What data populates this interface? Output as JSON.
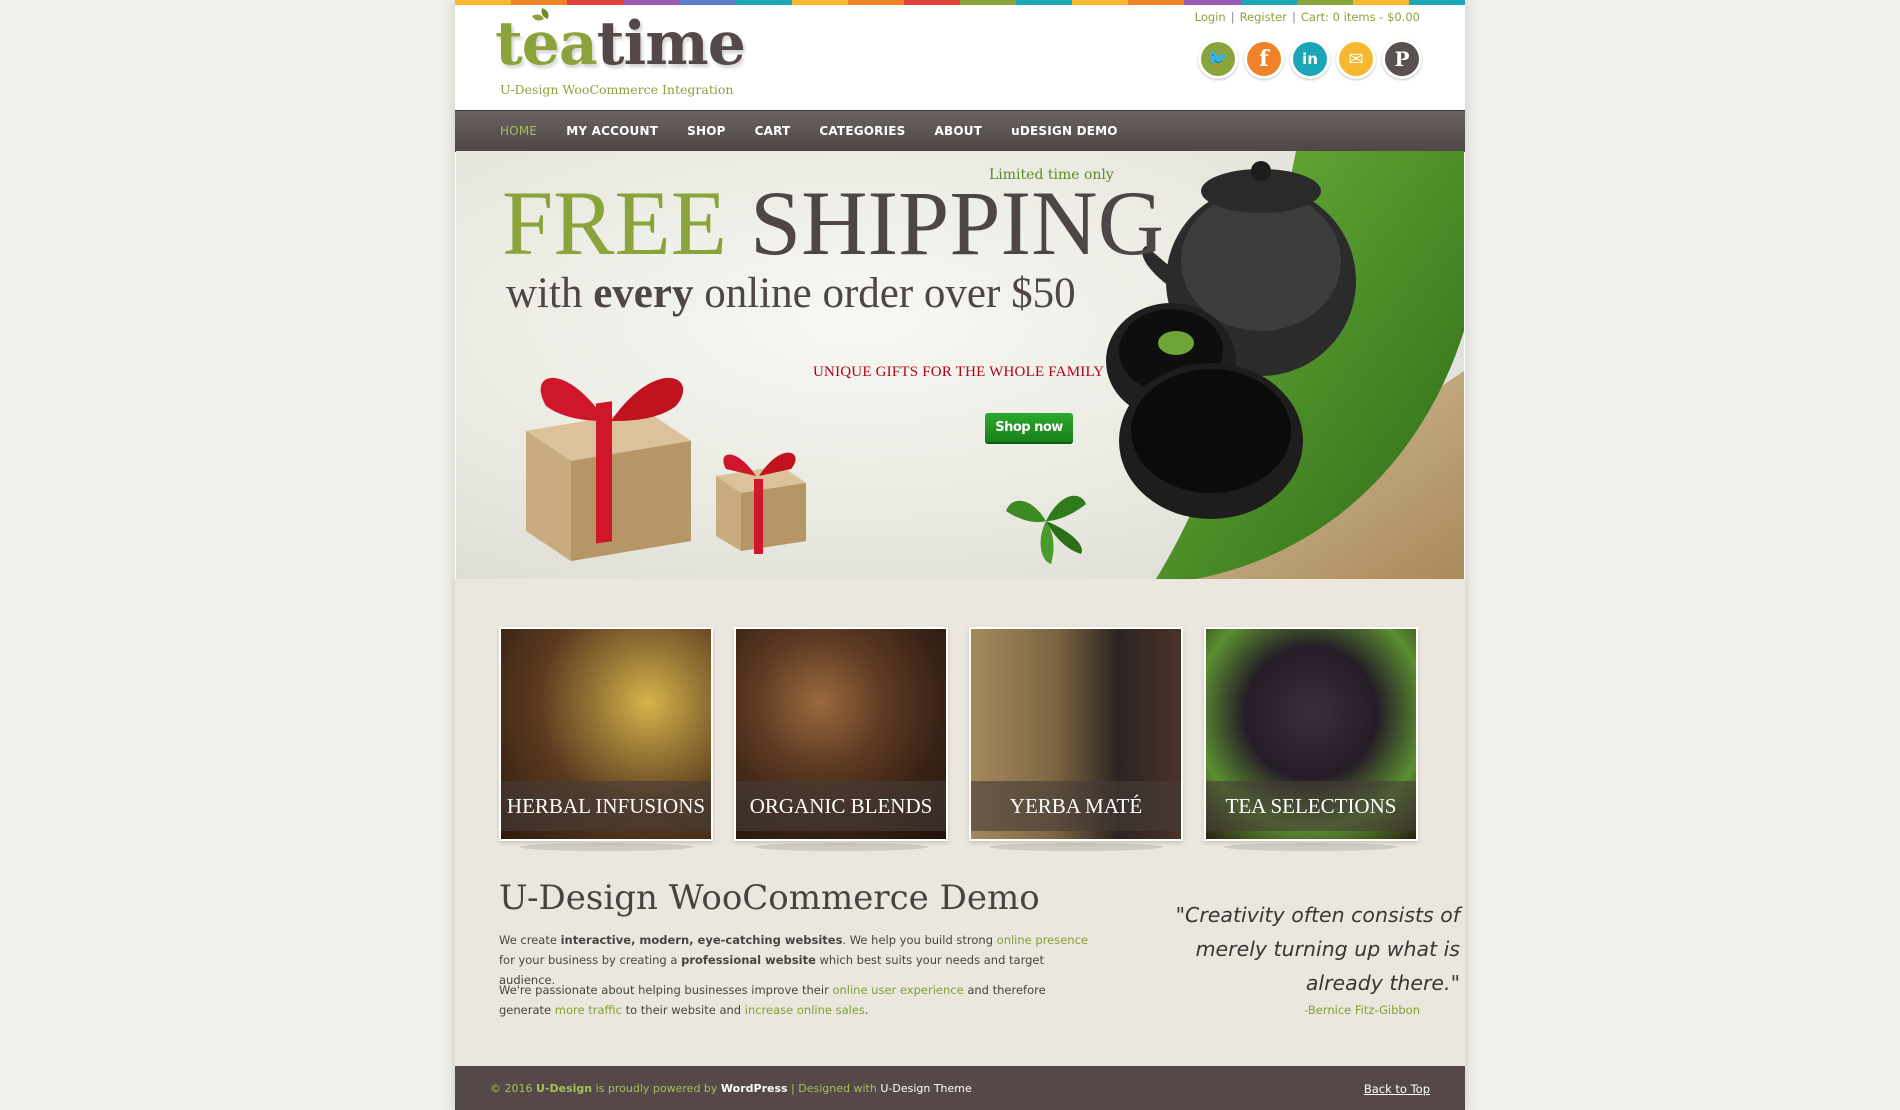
{
  "brand": {
    "logo_tea": "tea",
    "logo_time": "time",
    "tagline": "U-Design WooCommerce Integration"
  },
  "toplinks": {
    "login": "Login",
    "register": "Register",
    "cart": "Cart: 0 items - $0.00",
    "separator": "|"
  },
  "social": [
    {
      "name": "twitter-icon",
      "glyph": "🐦",
      "color": "#8aa33a"
    },
    {
      "name": "facebook-icon",
      "glyph": "f",
      "color": "#f0832a"
    },
    {
      "name": "linkedin-icon",
      "glyph": "in",
      "color": "#1aa6b7"
    },
    {
      "name": "email-icon",
      "glyph": "✉",
      "color": "#f5b82e"
    },
    {
      "name": "pinterest-icon",
      "glyph": "P",
      "color": "#5a5050"
    }
  ],
  "nav": {
    "items": [
      "HOME",
      "MY ACCOUNT",
      "SHOP",
      "CART",
      "CATEGORIES",
      "ABOUT",
      "uDESIGN DEMO"
    ],
    "active_index": 0
  },
  "banner": {
    "limited": "Limited time only",
    "free": "FREE",
    "shipping": "SHIPPING",
    "with": "with",
    "every": "every",
    "rest": "online order over $50",
    "unique": "UNIQUE GIFTS FOR THE WHOLE FAMILY",
    "shop_now": "Shop now"
  },
  "categories": [
    {
      "label": "HERBAL INFUSIONS"
    },
    {
      "label": "ORGANIC BLENDS"
    },
    {
      "label": "YERBA MATÉ"
    },
    {
      "label": "TEA SELECTIONS"
    }
  ],
  "content": {
    "heading": "U-Design WooCommerce Demo",
    "p1_a": "We create ",
    "p1_b": "interactive, modern, eye-catching websites",
    "p1_c": ". We help you build strong ",
    "p1_d": "online presence",
    "p1_e": " for your business by creating a ",
    "p1_f": "professional website",
    "p1_g": " which best suits your needs and target audience.",
    "p2_a": "We're passionate about helping businesses improve their ",
    "p2_b": "online user experience",
    "p2_c": " and therefore generate ",
    "p2_d": "more traffic",
    "p2_e": " to their website and ",
    "p2_f": "increase online sales",
    "p2_g": "."
  },
  "quote": {
    "line1": "\"Creativity often consists of",
    "line2": "merely turning up what is",
    "line3": "already there.\"",
    "author": "-Bernice Fitz-Gibbon"
  },
  "footer": {
    "copy": "© 2016 ",
    "udesign": "U-Design",
    "mid": " is proudly powered by ",
    "wordpress": "WordPress",
    "sep": " | Designed with ",
    "theme": "U-Design Theme",
    "back_to_top": "Back to Top"
  },
  "stripe_colors": [
    "#f5b82e",
    "#f0832a",
    "#e0443a",
    "#9b59b6",
    "#5d7fc9",
    "#1aa6b7",
    "#f5b82e",
    "#f0832a",
    "#e0443a",
    "#8aa33a",
    "#1aa6b7",
    "#f5b82e",
    "#f0832a",
    "#9b59b6",
    "#1aa6b7",
    "#8aa33a",
    "#f5b82e",
    "#1aa6b7"
  ]
}
